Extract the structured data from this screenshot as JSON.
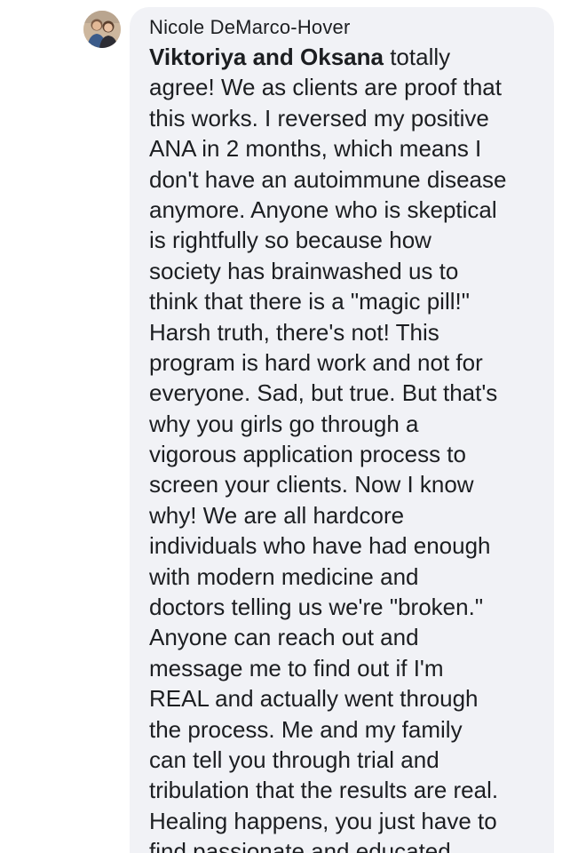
{
  "comment": {
    "author": "Nicole DeMarco-Hover",
    "mention": "Viktoriya and Oksana",
    "lines": [
      " totally",
      "agree! We as clients are proof that",
      "this works. I reversed my positive",
      "ANA in 2 months, which means I",
      "don't have an autoimmune disease",
      "anymore. Anyone who is skeptical",
      "is rightfully so because how",
      "society has brainwashed us to",
      "think that there is a \"magic pill!\"",
      "Harsh truth, there's not! This",
      "program is hard work and not for",
      "everyone. Sad, but true. But that's",
      "why you girls go through a",
      "vigorous application process to",
      "screen your clients. Now I know",
      "why! We are all hardcore",
      "individuals who have had enough",
      "with modern medicine and",
      "doctors telling us we're \"broken.\"",
      "Anyone can reach out and",
      "message me to find out if I'm",
      "REAL and actually went through",
      "the process. Me and my family",
      "can tell you through trial and",
      "tribulation that the results are real.",
      "Healing happens, you just have to",
      "find passionate and educated"
    ]
  },
  "colors": {
    "bubble": "#f1f2f6",
    "text": "#1c1e21"
  }
}
